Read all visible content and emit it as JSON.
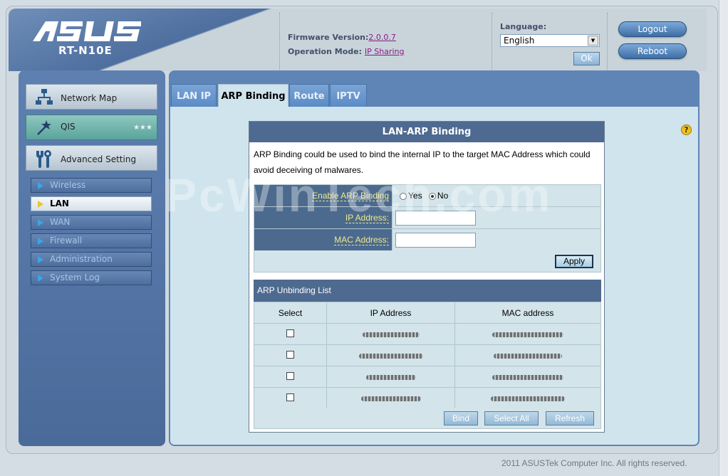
{
  "header": {
    "brand": "ASUS",
    "model": "RT-N10E",
    "firmware_label": "Firmware Version:",
    "firmware_value": "2.0.0.7",
    "opmode_label": "Operation Mode:",
    "opmode_value": "IP Sharing",
    "language_label": "Language:",
    "language_value": "English",
    "ok_label": "Ok",
    "logout_label": "Logout",
    "reboot_label": "Reboot"
  },
  "menu": {
    "main": [
      {
        "label": "Network Map",
        "icon": "network-map-icon"
      },
      {
        "label": "QIS",
        "icon": "magic-wand-icon"
      },
      {
        "label": "Advanced Setting",
        "icon": "tools-icon"
      }
    ],
    "sub": [
      {
        "label": "Wireless"
      },
      {
        "label": "LAN"
      },
      {
        "label": "WAN"
      },
      {
        "label": "Firewall"
      },
      {
        "label": "Administration"
      },
      {
        "label": "System Log"
      }
    ],
    "active_sub": "LAN"
  },
  "tabs": [
    "LAN IP",
    "ARP Binding",
    "Route",
    "IPTV"
  ],
  "active_tab": "ARP Binding",
  "panel": {
    "title": "LAN-ARP Binding",
    "description": "ARP Binding could be used to bind the internal IP to the target MAC Address which could avoid deceiving of malwares.",
    "enable_label": "Enable ARP Binding",
    "yes_label": "Yes",
    "no_label": "No",
    "enable_value": "No",
    "ip_label": "IP Address:",
    "ip_value": "",
    "mac_label": "MAC Address:",
    "mac_value": "",
    "apply_label": "Apply",
    "list_title": "ARP Unbinding List",
    "columns": [
      "Select",
      "IP Address",
      "MAC address"
    ],
    "rows_count_note": "4 rows, values obscured",
    "bind_label": "Bind",
    "select_all_label": "Select All",
    "refresh_label": "Refresh"
  },
  "watermark": "PcWinTech.com",
  "footer": "2011 ASUSTek Computer Inc. All rights reserved.",
  "colors": {
    "accent_blue": "#4e6a90",
    "label_yellow": "#ece98a",
    "content_bg": "#d0e4ed"
  }
}
